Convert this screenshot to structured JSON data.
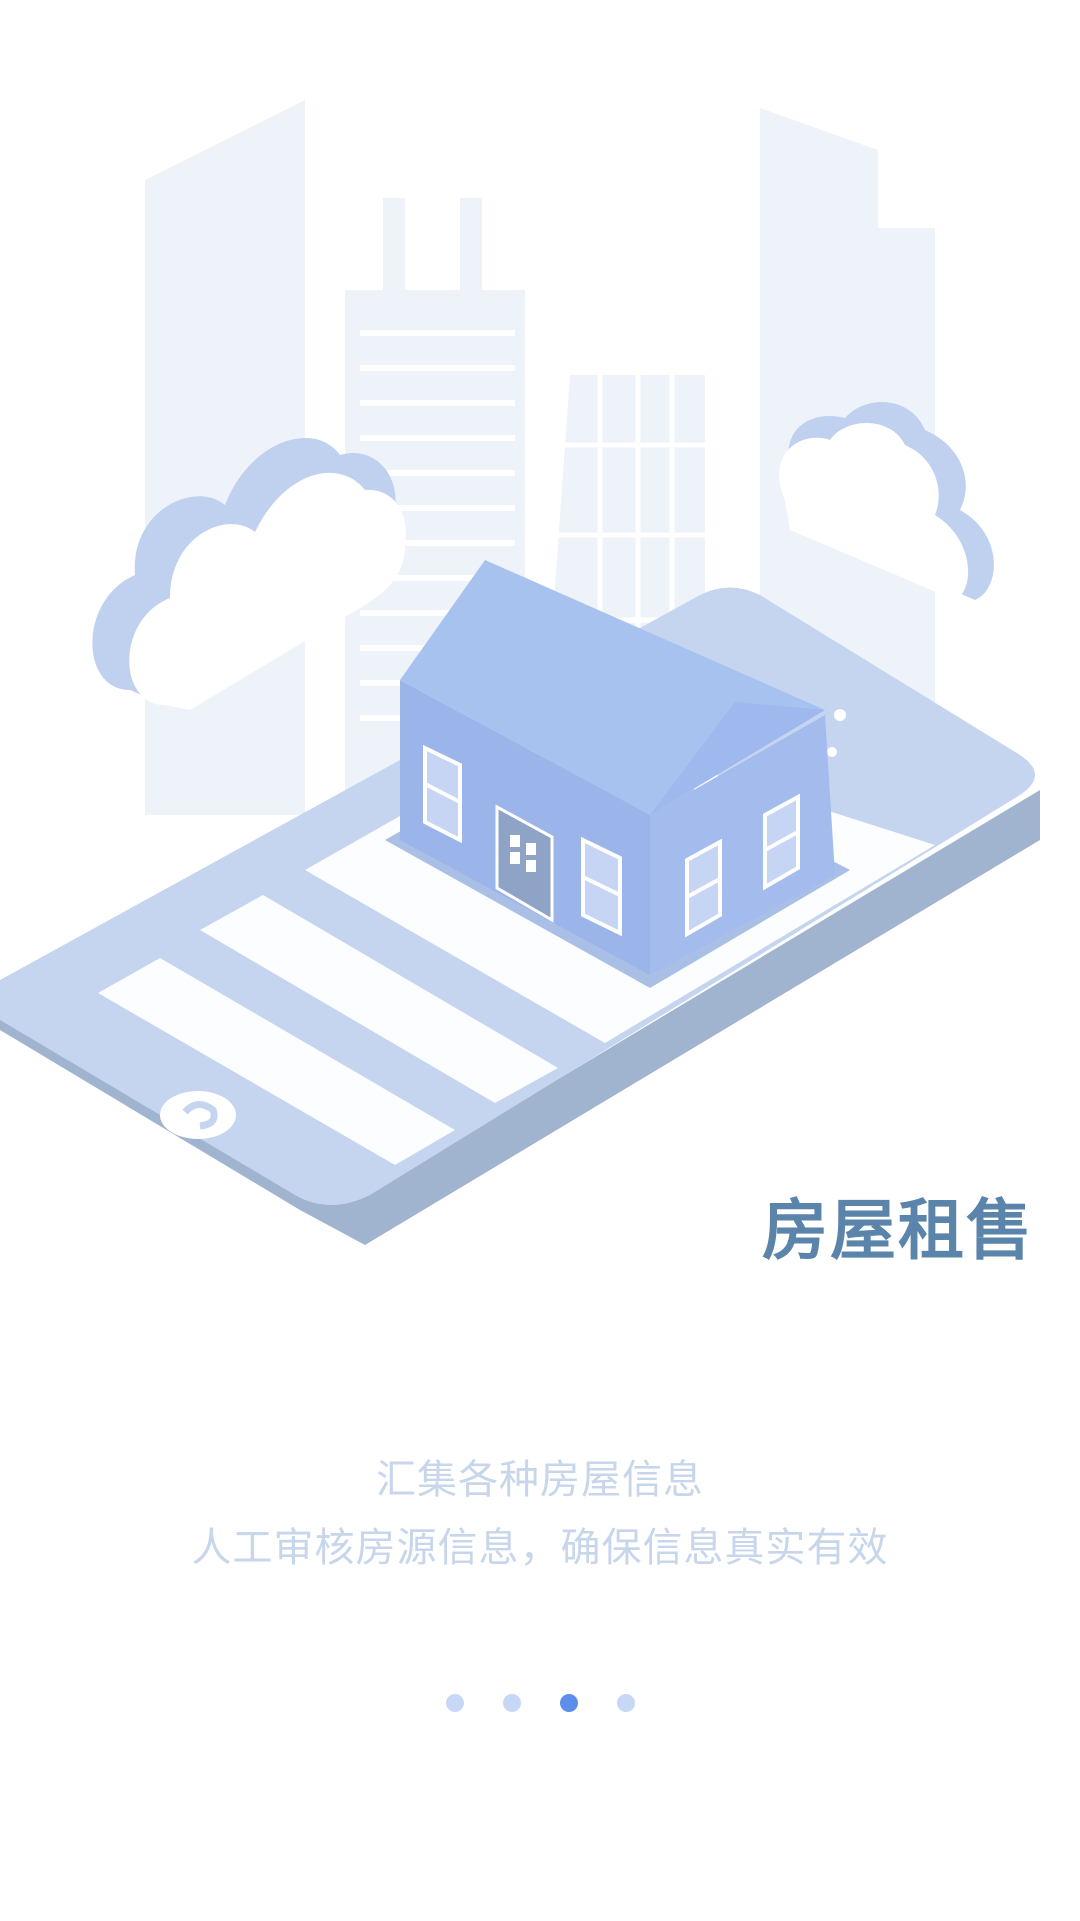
{
  "guide": {
    "title": "房屋租售",
    "description_line_1": "汇集各种房屋信息",
    "description_line_2": "人工审核房源信息，确保信息真实有效"
  },
  "page_indicator": {
    "total": 4,
    "active_index": 2
  },
  "colors": {
    "title": "#5b84ab",
    "description": "#c8d6ec",
    "dot_inactive": "#c7d8f6",
    "dot_active": "#5d8ee9",
    "building": "#eef3fa",
    "phone_body": "#c5d5ef",
    "house_front": "#9bb4ea",
    "house_roof": "#a8c2f0"
  },
  "icons": {
    "illustration": "phone-with-house-illustration"
  }
}
